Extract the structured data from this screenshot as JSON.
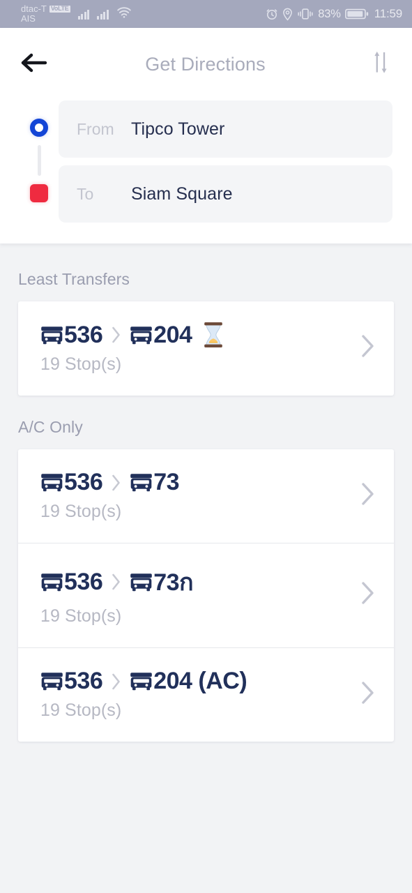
{
  "statusbar": {
    "carrier_primary": "dtac-T",
    "volte_badge": "VoLTE",
    "carrier_secondary": "AIS",
    "icons": [
      "signal-bars-icon",
      "signal-bars-icon",
      "wifi-icon",
      "alarm-clock-icon",
      "location-pin-icon",
      "vibrate-icon",
      "battery-icon"
    ],
    "battery_percent": "83%",
    "time": "11:59"
  },
  "header": {
    "back_icon": "arrow-left-icon",
    "title": "Get Directions",
    "swap_icon": "swap-vertical-icon"
  },
  "endpoints": {
    "origin_marker": "origin-dot-icon",
    "destination_marker": "destination-square-icon",
    "from": {
      "label": "From",
      "value": "Tipco Tower",
      "placeholder": "From"
    },
    "to": {
      "label": "To",
      "value": "Siam Square",
      "placeholder": "To"
    }
  },
  "colors": {
    "accent_blue": "#1345d6",
    "accent_red": "#ef2b40",
    "route_navy": "#21305a",
    "muted_text": "#b6b8c3",
    "section_text": "#9a9daf",
    "page_bg": "#f2f3f5",
    "card_bg": "#ffffff",
    "field_bg": "#f4f5f7",
    "statusbar_bg": "#a4a8bd"
  },
  "sections": [
    {
      "title": "Least Transfers",
      "routes": [
        {
          "legs": [
            "536",
            "204"
          ],
          "leg_icon": "bus-icon",
          "separator": "chevron-right-icon",
          "badge": "hourglass-icon",
          "stops": "19 Stop(s)",
          "chevron": "chevron-right-icon"
        }
      ]
    },
    {
      "title": "A/C Only",
      "routes": [
        {
          "legs": [
            "536",
            "73"
          ],
          "leg_icon": "bus-icon",
          "separator": "chevron-right-icon",
          "badge": "",
          "stops": "19 Stop(s)",
          "chevron": "chevron-right-icon"
        },
        {
          "legs": [
            "536",
            "73ก"
          ],
          "leg_icon": "bus-icon",
          "separator": "chevron-right-icon",
          "badge": "",
          "stops": "19 Stop(s)",
          "chevron": "chevron-right-icon"
        },
        {
          "legs": [
            "536",
            "204 (AC)"
          ],
          "leg_icon": "bus-icon",
          "separator": "chevron-right-icon",
          "badge": "",
          "stops": "19 Stop(s)",
          "chevron": "chevron-right-icon"
        }
      ]
    }
  ]
}
